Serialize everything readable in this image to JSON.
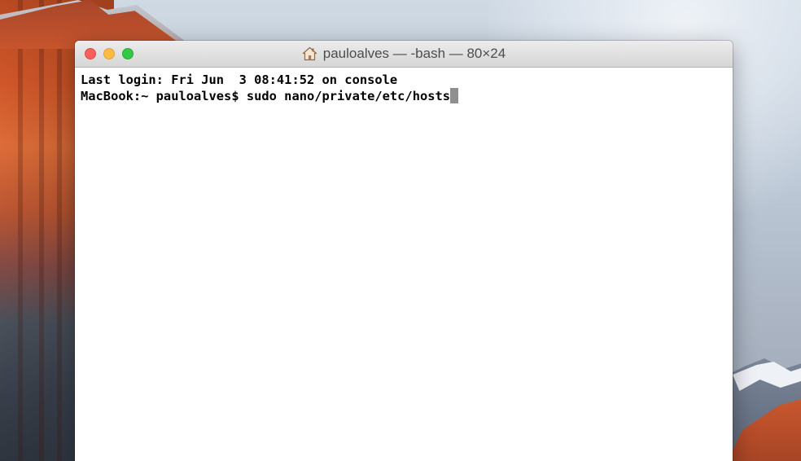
{
  "window": {
    "title": "pauloalves — -bash — 80×24",
    "title_icon": "home-icon"
  },
  "terminal": {
    "lines": [
      "Last login: Fri Jun  3 08:41:52 on console",
      "MacBook:~ pauloalves$ sudo nano/private/etc/hosts"
    ],
    "cursor_color": "#8f8f8f"
  },
  "colors": {
    "close": "#fc605c",
    "minimize": "#fdbc40",
    "zoom": "#34c84a"
  }
}
